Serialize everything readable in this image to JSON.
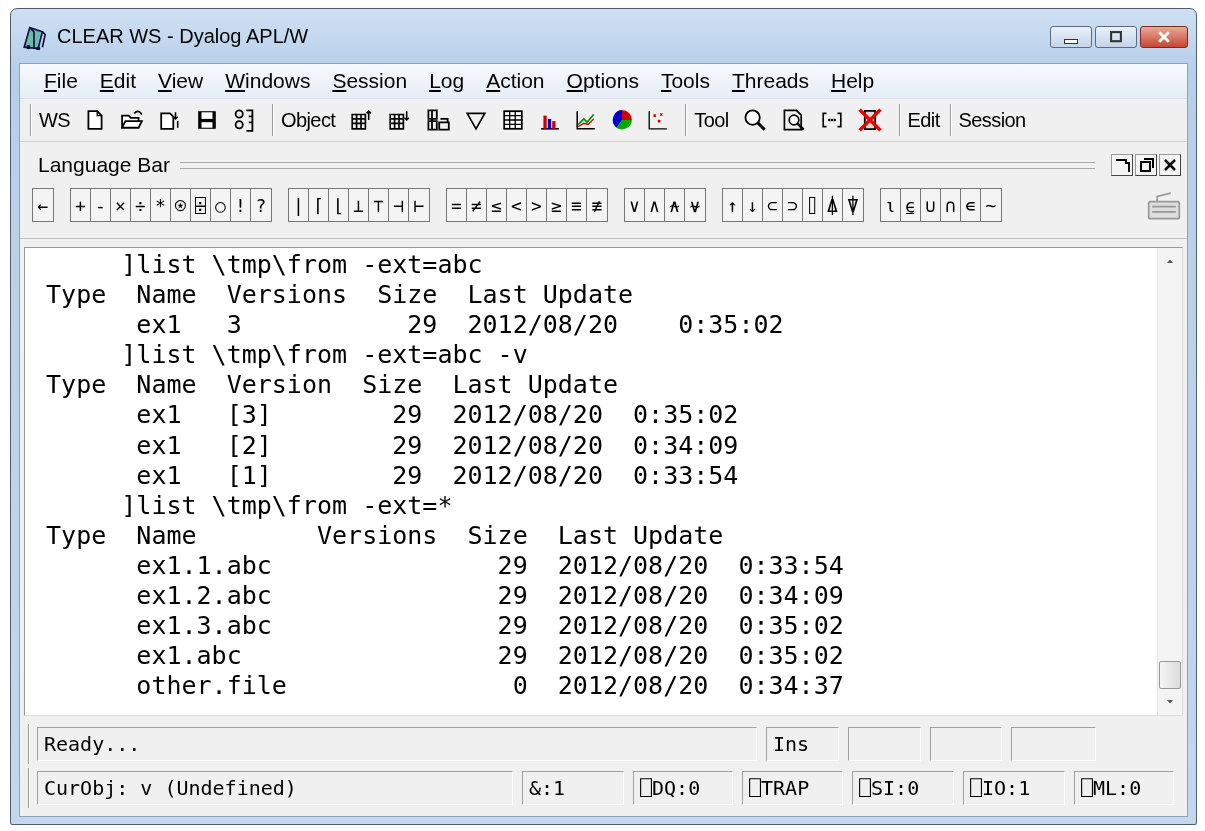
{
  "window": {
    "title": "CLEAR WS - Dyalog APL/W"
  },
  "menu": [
    "File",
    "Edit",
    "View",
    "Windows",
    "Session",
    "Log",
    "Action",
    "Options",
    "Tools",
    "Threads",
    "Help"
  ],
  "toolbar": [
    {
      "kind": "workspace",
      "label": "WS"
    },
    {
      "kind": "object",
      "label": "Object"
    },
    {
      "kind": "tool",
      "label": "Tool"
    },
    {
      "kind": "edit",
      "label": "Edit"
    },
    {
      "kind": "session",
      "label": "Session"
    }
  ],
  "language_bar": {
    "title": "Language Bar",
    "groups": [
      [
        "←"
      ],
      [
        "+",
        "-",
        "×",
        "÷",
        "*",
        "⍟",
        "⌹",
        "○",
        "!",
        "?"
      ],
      [
        "|",
        "⌈",
        "⌊",
        "⊥",
        "⊤",
        "⊣",
        "⊢"
      ],
      [
        "=",
        "≠",
        "≤",
        "<",
        ">",
        "≥",
        "≡",
        "≢"
      ],
      [
        "∨",
        "∧",
        "⍲",
        "⍱"
      ],
      [
        "↑",
        "↓",
        "⊂",
        "⊃",
        "⌷",
        "⍋",
        "⍒"
      ],
      [
        "⍳",
        "⍷",
        "∪",
        "∩",
        "∊",
        "~"
      ]
    ]
  },
  "session_log": [
    "      ]list \\tmp\\from -ext=abc",
    " Type  Name  Versions  Size  Last Update",
    "       ex1   3           29  2012/08/20    0:35:02",
    "      ]list \\tmp\\from -ext=abc -v",
    " Type  Name  Version  Size  Last Update",
    "       ex1   [3]        29  2012/08/20  0:35:02",
    "       ex1   [2]        29  2012/08/20  0:34:09",
    "       ex1   [1]        29  2012/08/20  0:33:54",
    "      ]list \\tmp\\from -ext=*",
    " Type  Name        Versions  Size  Last Update",
    "       ex1.1.abc               29  2012/08/20  0:33:54",
    "       ex1.2.abc               29  2012/08/20  0:34:09",
    "       ex1.3.abc               29  2012/08/20  0:35:02",
    "       ex1.abc                 29  2012/08/20  0:35:02",
    "       other.file               0  2012/08/20  0:34:37"
  ],
  "status_bar": {
    "row_1": [
      "Ready...",
      "Ins"
    ],
    "row_2": [
      "CurObj: v (Undefined)",
      "&:1",
      "⎕DQ:0",
      "⎕TRAP",
      "⎕SI:0",
      "⎕IO:1",
      "⎕ML:0"
    ]
  }
}
